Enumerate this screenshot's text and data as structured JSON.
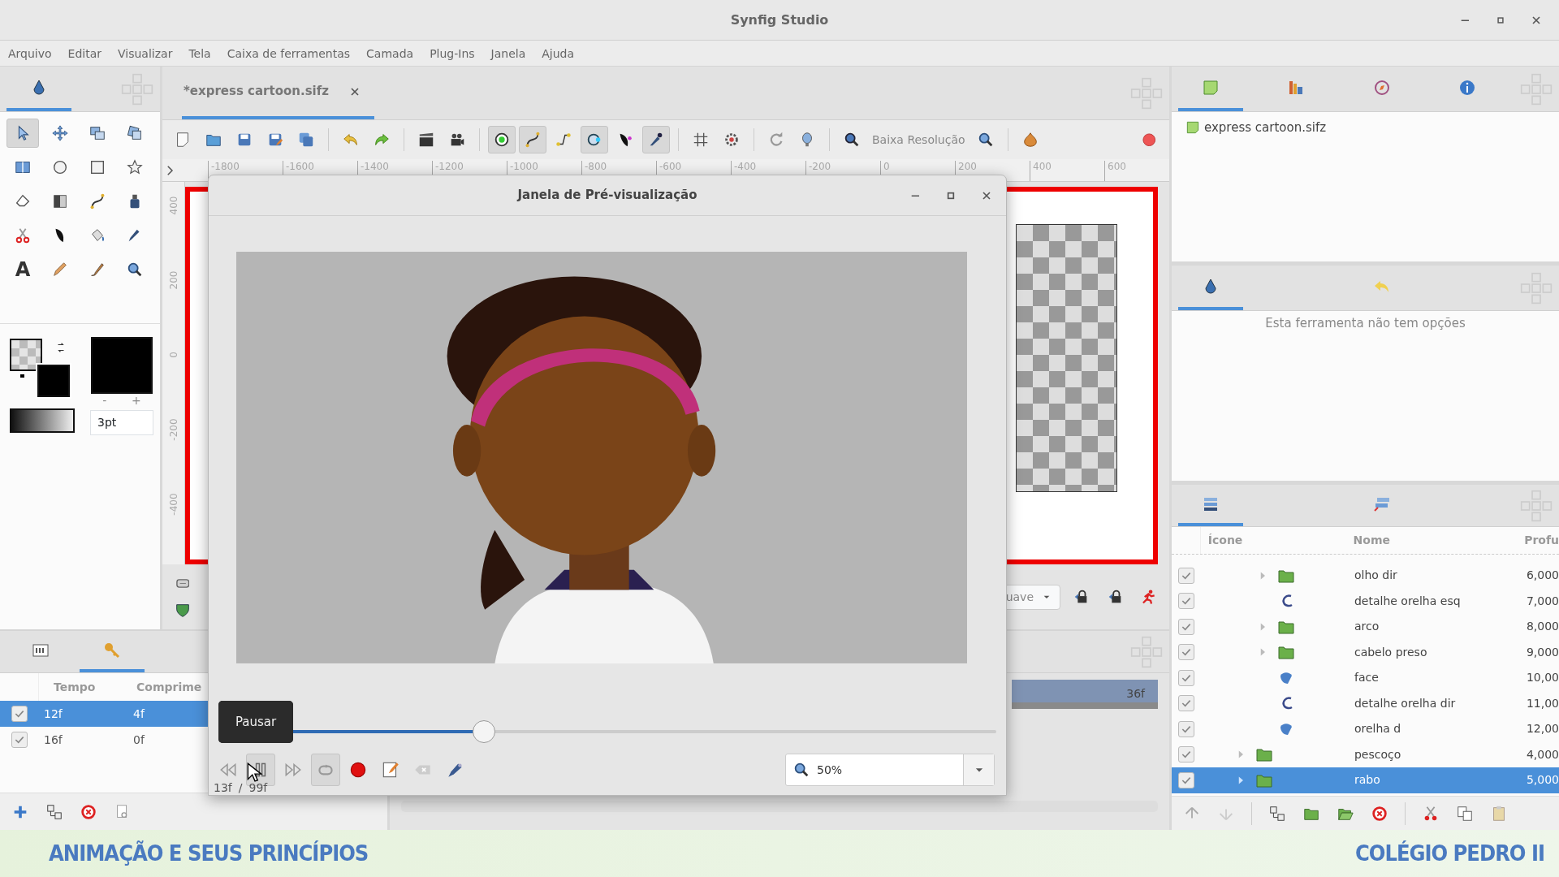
{
  "window": {
    "title": "Synfig Studio"
  },
  "menu": [
    "Arquivo",
    "Editar",
    "Visualizar",
    "Tela",
    "Caixa de ferramentas",
    "Camada",
    "Plug-Ins",
    "Janela",
    "Ajuda"
  ],
  "toolbox": {
    "tabs": [
      {
        "selected": true
      }
    ],
    "tools": [
      {
        "selected": true
      },
      {
        "selected": false
      },
      {
        "selected": false
      },
      {
        "selected": false
      },
      {
        "selected": false
      },
      {
        "selected": false
      },
      {
        "selected": false
      },
      {
        "selected": false
      },
      {
        "selected": false
      },
      {
        "selected": false
      },
      {
        "selected": false
      },
      {
        "selected": false
      },
      {
        "selected": false
      },
      {
        "selected": false
      },
      {
        "selected": false
      },
      {
        "selected": false
      },
      {
        "selected": false,
        "label": "A"
      },
      {
        "selected": false
      },
      {
        "selected": false
      },
      {
        "selected": false
      }
    ],
    "width_minus": "-",
    "width_plus": "+",
    "width_field": "3pt"
  },
  "document_tab": {
    "title": "*express cartoon.sifz"
  },
  "canvas_toolbar": {
    "toggles": [
      {
        "on": true
      },
      {
        "on": true
      },
      {
        "on": false
      },
      {
        "on": true
      },
      {
        "on": false
      },
      {
        "on": true
      }
    ],
    "resolution_label": "Baixa Resolução"
  },
  "ruler": {
    "horizontal": [
      "-1800",
      "-1600",
      "-1400",
      "-1200",
      "-1000",
      "-800",
      "-600",
      "-400",
      "-200",
      "0",
      "200",
      "400",
      "600"
    ],
    "vertical": [
      "400",
      "200",
      "0",
      "-200",
      "-400"
    ]
  },
  "canvas_bottom": {
    "interpolation": "uave"
  },
  "keyframes": {
    "tabs": [
      {
        "selected": false
      },
      {
        "selected": true
      }
    ],
    "columns": [
      "Tempo",
      "Comprime"
    ],
    "rows": [
      {
        "checked": true,
        "selected": true,
        "time": "12f",
        "length": "4f"
      },
      {
        "checked": true,
        "selected": false,
        "time": "16f",
        "length": "0f"
      }
    ]
  },
  "timeline": {
    "end_label": "36f"
  },
  "preview": {
    "title": "Janela de Pré-visualização",
    "tooltip": "Pausar",
    "level": 0.34,
    "controls": [
      {
        "pressed": false
      },
      {
        "pressed": true
      },
      {
        "pressed": false
      },
      {
        "pressed": true
      },
      {
        "pressed": false
      },
      {
        "pressed": false
      },
      {
        "pressed": false
      },
      {
        "pressed": false
      }
    ],
    "current_frame": "13f",
    "separator": "/",
    "total_frames": "99f",
    "zoom": "50%"
  },
  "canvas_browser": {
    "tabs": [
      {
        "selected": true
      },
      {
        "selected": false
      },
      {
        "selected": false
      },
      {
        "selected": false
      }
    ],
    "file": "express cartoon.sifz"
  },
  "tool_options": {
    "tabs": [
      {
        "selected": true
      },
      {
        "selected": false
      }
    ],
    "message": "Esta ferramenta não tem opções"
  },
  "layers": {
    "tabs": [
      {
        "selected": true
      },
      {
        "selected": false
      }
    ],
    "columns": [
      "Ícone",
      "Nome",
      "Profu"
    ],
    "items": [
      {
        "children": [
          {
            "checked": true,
            "expander": true,
            "kind": "group",
            "name": "olho dir",
            "depth": "6,000",
            "selected": false
          },
          {
            "checked": true,
            "expander": false,
            "kind": "outline",
            "name": "detalhe orelha esq",
            "depth": "7,000",
            "selected": false
          },
          {
            "checked": true,
            "expander": true,
            "kind": "group",
            "name": "arco",
            "depth": "8,000",
            "selected": false
          },
          {
            "checked": true,
            "expander": true,
            "kind": "group",
            "name": "cabelo preso",
            "depth": "9,000",
            "selected": false
          },
          {
            "checked": true,
            "expander": false,
            "kind": "region",
            "name": "face",
            "depth": "10,00",
            "selected": false
          },
          {
            "checked": true,
            "expander": false,
            "kind": "outline",
            "name": "detalhe orelha dir",
            "depth": "11,00",
            "selected": false
          },
          {
            "checked": true,
            "expander": false,
            "kind": "region",
            "name": "orelha d",
            "depth": "12,00",
            "selected": false
          }
        ]
      },
      {
        "checked": true,
        "expander": true,
        "kind": "group",
        "name": "pescoço",
        "depth": "4,000",
        "selected": false
      },
      {
        "checked": true,
        "expander": true,
        "kind": "group",
        "name": "rabo",
        "depth": "5,000",
        "selected": true
      }
    ]
  },
  "banner": {
    "left": "ANIMAÇÃO E SEUS PRINCÍPIOS",
    "right": "COLÉGIO PEDRO II"
  }
}
